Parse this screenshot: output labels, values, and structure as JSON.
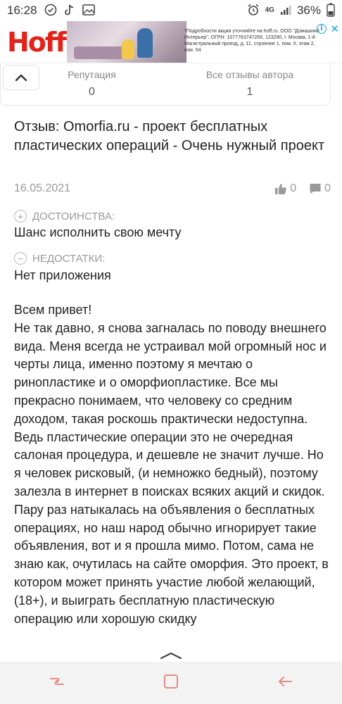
{
  "status_bar": {
    "time": "16:28",
    "signal": "4G",
    "battery": "36%"
  },
  "ad": {
    "brand": "Hoff",
    "disclaimer": "*Подробности акции уточняйте на hoff.ru. ООО \"Домашний Интерьер\", ОГРН: 1077763747269, 123290, г. Москва, 1-й Магистральный проезд, д. 11, строение 1, пом. II, этаж 2, ком. 54"
  },
  "reputation": {
    "label": "Репутация",
    "value": "0"
  },
  "all_reviews": {
    "label": "Все отзывы автора",
    "value": "1"
  },
  "review": {
    "title": "Отзыв: Omorfia.ru - проект бесплатных пластических операций - Очень нужный проект",
    "date": "16.05.2021",
    "likes": "0",
    "comments": "0",
    "pros_label": "ДОСТОИНСТВА:",
    "pros": "Шанс исполнить свою мечту",
    "cons_label": "НЕДОСТАТКИ:",
    "cons": "Нет приложения",
    "greeting": "Всем привет!",
    "body": "Не так давно, я снова загналась по поводу внешнего вида. Меня всегда не устраивал мой огромный нос и черты лица, именно поэтому я мечтаю о ринопластике и о оморфиопластике. Все мы прекрасно понимаем, что человеку со средним доходом, такая роскошь практически недоступна. Ведь пластические операции это не очередная салоная процедура, и дешевле не значит лучше. Но я человек рисковый, (и немножко бедный), поэтому залезла в интернет в поисках всяких акций и скидок. Пару раз натыкалась на объявления о бесплатных операциях, но наш народ обычно игнорирует такие объявления, вот и я прошла мимо. Потом, сама не знаю как, очутилась на сайте оморфия. Это проект, в котором может принять участие любой желающий, (18+), и выиграть бесплатную пластическую операцию или хорошую скидку"
  },
  "colors": {
    "brand_red": "#e2231a",
    "ad_info": "#19a5d9",
    "nav_icon": "#e58a87"
  }
}
